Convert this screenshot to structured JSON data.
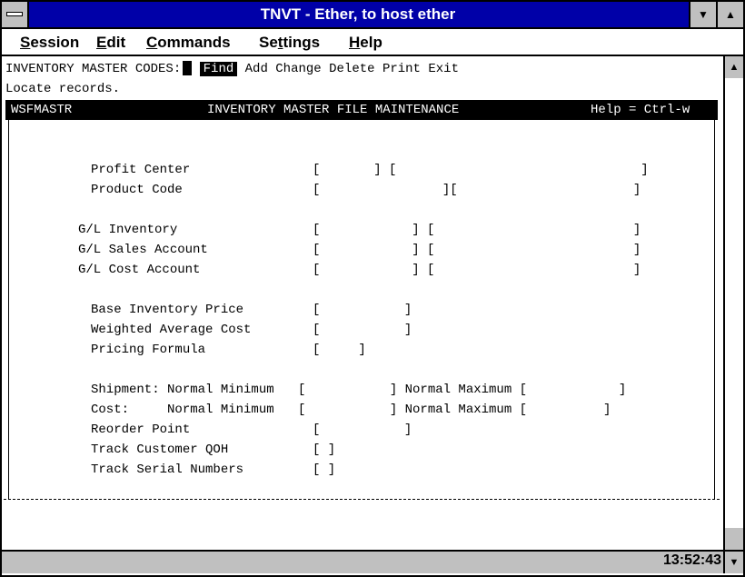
{
  "window": {
    "title": "TNVT - Ether, to host ether"
  },
  "menu": [
    "Session",
    "Edit",
    "Commands",
    "Settings",
    "Help"
  ],
  "menu_underline": [
    "S",
    "E",
    "C",
    "t",
    "H"
  ],
  "terminal": {
    "prompt": "INVENTORY MASTER CODES:",
    "commands": [
      "Find",
      "Add",
      "Change",
      "Delete",
      "Print",
      "Exit"
    ],
    "message": "Locate records.",
    "header": {
      "program": "WSFMASTR",
      "screen_title": "INVENTORY MASTER FILE MAINTENANCE",
      "help": "Help = Ctrl-w"
    },
    "fields": [
      {
        "label": "Profit Center",
        "brackets": "[       ] [                                ]"
      },
      {
        "label": "Product Code",
        "brackets": "[                ][                       ]"
      },
      {
        "label": "G/L Inventory",
        "brackets": "[            ] [                          ]"
      },
      {
        "label": "G/L Sales Account",
        "brackets": "[            ] [                          ]"
      },
      {
        "label": "G/L Cost Account",
        "brackets": "[            ] [                          ]"
      },
      {
        "label": "Base Inventory Price",
        "brackets": "[           ]"
      },
      {
        "label": "Weighted Average Cost",
        "brackets": "[           ]"
      },
      {
        "label": "Pricing Formula",
        "brackets": "[     ]"
      },
      {
        "label": "Shipment: Normal Minimum",
        "brackets": "[           ] Normal Maximum [            ]"
      },
      {
        "label": "Cost:     Normal Minimum",
        "brackets": "[           ] Normal Maximum [          ]"
      },
      {
        "label": "Reorder Point",
        "brackets": "[           ]"
      },
      {
        "label": "Track Customer QOH",
        "brackets": "[ ]"
      },
      {
        "label": "Track Serial Numbers",
        "brackets": "[ ]"
      }
    ]
  },
  "status": {
    "clock": "13:52:43"
  }
}
